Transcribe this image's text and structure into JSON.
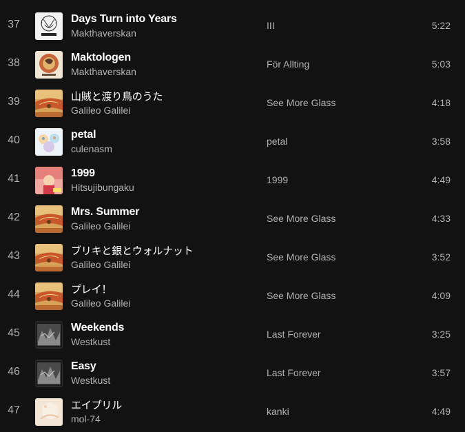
{
  "tracks": [
    {
      "number": "37",
      "title": "Days Turn into Years",
      "artist": "Makthaverskan",
      "album": "III",
      "duration": "5:22",
      "art": "makthaverskan-iii",
      "title_style": "bold"
    },
    {
      "number": "38",
      "title": "Maktologen",
      "artist": "Makthaverskan",
      "album": "För Allting",
      "duration": "5:03",
      "art": "for-allting",
      "title_style": "bold"
    },
    {
      "number": "39",
      "title": "山賊と渡り鳥のうた",
      "artist": "Galileo Galilei",
      "album": "See More Glass",
      "duration": "4:18",
      "art": "see-more-glass",
      "title_style": "thin"
    },
    {
      "number": "40",
      "title": "petal",
      "artist": "culenasm",
      "album": "petal",
      "duration": "3:58",
      "art": "petal",
      "title_style": "bold"
    },
    {
      "number": "41",
      "title": "1999",
      "artist": "Hitsujibungaku",
      "album": "1999",
      "duration": "4:49",
      "art": "1999",
      "title_style": "bold"
    },
    {
      "number": "42",
      "title": "Mrs. Summer",
      "artist": "Galileo Galilei",
      "album": "See More Glass",
      "duration": "4:33",
      "art": "see-more-glass",
      "title_style": "bold"
    },
    {
      "number": "43",
      "title": "ブリキと銀とウォルナット",
      "artist": "Galileo Galilei",
      "album": "See More Glass",
      "duration": "3:52",
      "art": "see-more-glass",
      "title_style": "thin"
    },
    {
      "number": "44",
      "title": "プレイ！",
      "artist": "Galileo Galilei",
      "album": "See More Glass",
      "duration": "4:09",
      "art": "see-more-glass",
      "title_style": "thin"
    },
    {
      "number": "45",
      "title": "Weekends",
      "artist": "Westkust",
      "album": "Last Forever",
      "duration": "3:25",
      "art": "last-forever",
      "title_style": "bold"
    },
    {
      "number": "46",
      "title": "Easy",
      "artist": "Westkust",
      "album": "Last Forever",
      "duration": "3:57",
      "art": "last-forever",
      "title_style": "bold"
    },
    {
      "number": "47",
      "title": "エイプリル",
      "artist": "mol-74",
      "album": "kanki",
      "duration": "4:49",
      "art": "kanki",
      "title_style": "thin"
    }
  ],
  "colors": {
    "background": "#121212",
    "primary_text": "#ffffff",
    "secondary_text": "#b3b3b3"
  }
}
